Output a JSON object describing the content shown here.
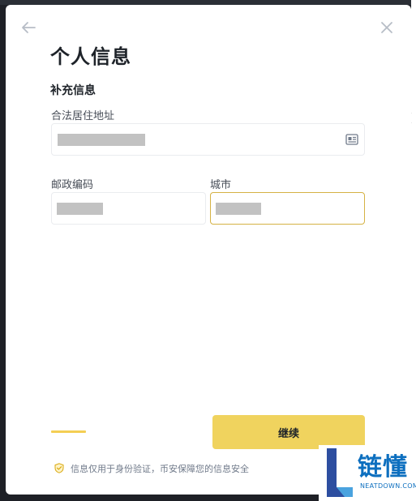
{
  "dialog": {
    "title": "个人信息",
    "section_title": "补充信息"
  },
  "fields": {
    "address": {
      "label": "合法居住地址"
    },
    "postcode": {
      "label": "邮政编码"
    },
    "city": {
      "label": "城市"
    }
  },
  "actions": {
    "continue_label": "继续"
  },
  "footer": {
    "privacy_text": "信息仅用于身份验证，币安保障您的信息安全"
  },
  "watermark": {
    "brand": "链懂",
    "domain": "NEATDOWN.COM"
  },
  "colors": {
    "accent": "#f0b90b",
    "button": "#f0d35e",
    "focus_border": "#d5b244",
    "redaction": "#c2c2c2"
  }
}
